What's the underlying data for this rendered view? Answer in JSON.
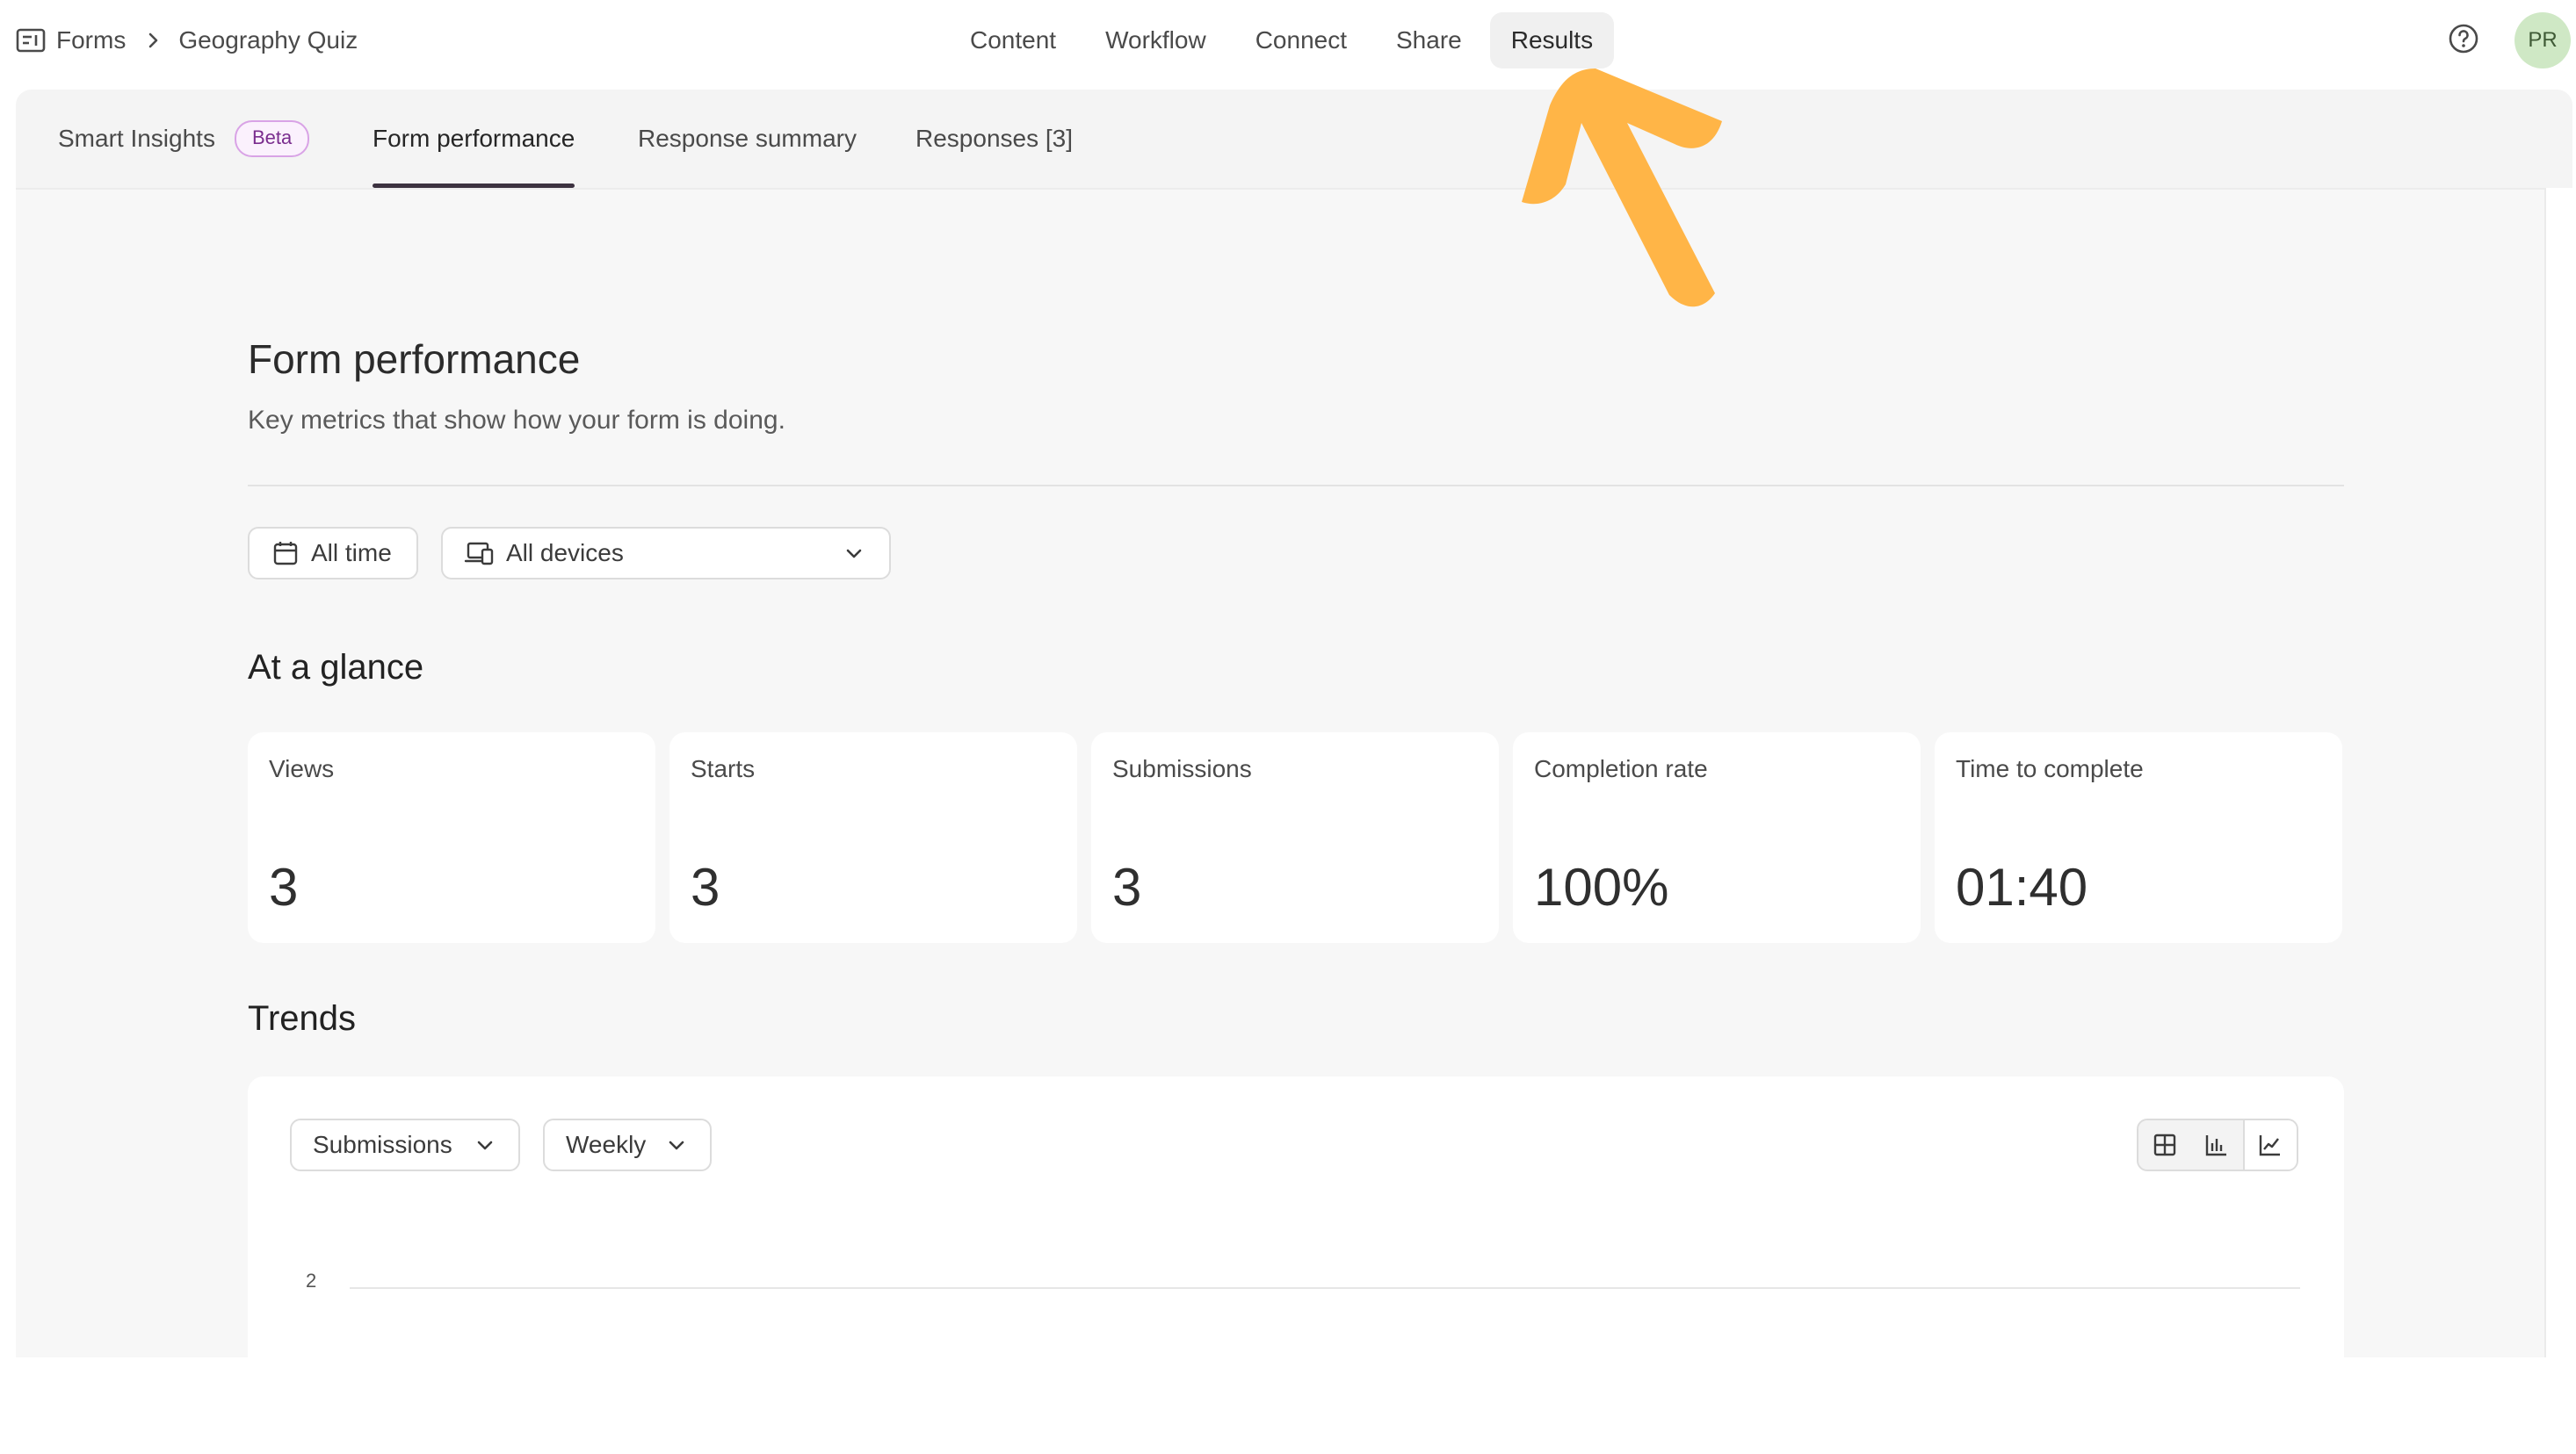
{
  "breadcrumb": {
    "root": "Forms",
    "current": "Geography Quiz"
  },
  "topnav": {
    "items": [
      {
        "label": "Content"
      },
      {
        "label": "Workflow"
      },
      {
        "label": "Connect"
      },
      {
        "label": "Share"
      },
      {
        "label": "Results",
        "active": true
      }
    ]
  },
  "user": {
    "initials": "PR"
  },
  "tabs": [
    {
      "label": "Smart Insights",
      "badge": "Beta"
    },
    {
      "label": "Form performance",
      "active": true
    },
    {
      "label": "Response summary"
    },
    {
      "label": "Responses [3]"
    }
  ],
  "page": {
    "title": "Form performance",
    "subtitle": "Key metrics that show how your form is doing."
  },
  "filters": {
    "date": "All time",
    "device": "All devices"
  },
  "glance": {
    "title": "At a glance",
    "metrics": [
      {
        "label": "Views",
        "value": "3"
      },
      {
        "label": "Starts",
        "value": "3"
      },
      {
        "label": "Submissions",
        "value": "3"
      },
      {
        "label": "Completion rate",
        "value": "100%"
      },
      {
        "label": "Time to complete",
        "value": "01:40"
      }
    ]
  },
  "trends": {
    "title": "Trends",
    "metric": "Submissions",
    "interval": "Weekly",
    "y_tick": "2"
  },
  "colors": {
    "accent": "#3c3240",
    "avatar_bg": "#cfe8c5",
    "arrow": "#ffb547",
    "beta_border": "#d9a3e6"
  }
}
